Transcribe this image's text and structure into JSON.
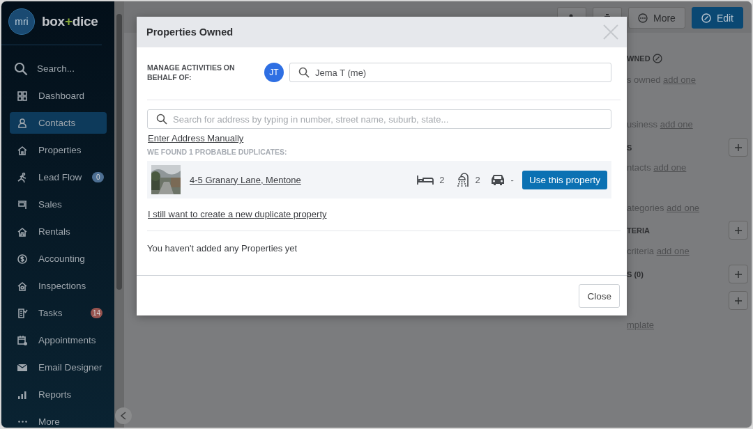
{
  "brand": {
    "mark": "mri",
    "word_1": "box",
    "joiner": "+",
    "word_2": "dice"
  },
  "sidebar": {
    "search": "Search...",
    "items": [
      {
        "label": "Dashboard",
        "selected": false
      },
      {
        "label": "Contacts",
        "selected": true
      },
      {
        "label": "Properties",
        "selected": false
      },
      {
        "label": "Lead Flow",
        "selected": false,
        "badge": {
          "text": "0",
          "color": "#4d6f93"
        }
      },
      {
        "label": "Sales",
        "selected": false
      },
      {
        "label": "Rentals",
        "selected": false
      },
      {
        "label": "Accounting",
        "selected": false
      },
      {
        "label": "Inspections",
        "selected": false
      },
      {
        "label": "Tasks",
        "selected": false,
        "badge": {
          "text": "14",
          "color": "#97544f"
        }
      },
      {
        "label": "Appointments",
        "selected": false
      },
      {
        "label": "Email Designer",
        "selected": false
      },
      {
        "label": "Reports",
        "selected": false
      },
      {
        "label": "More",
        "selected": false
      }
    ]
  },
  "page": {
    "actions": [
      {
        "kind": "secondary"
      },
      {
        "kind": "secondary"
      },
      {
        "label": "More",
        "kind": "secondary"
      },
      {
        "label": "Edit",
        "kind": "primary"
      }
    ]
  },
  "right_panel": [
    {
      "kind": "heading",
      "text": "WNED",
      "editable": true,
      "addable": false
    },
    {
      "kind": "hint",
      "text": "s owned",
      "link": "add one"
    },
    {
      "kind": "hint",
      "text": "usiness",
      "link": "add one"
    },
    {
      "kind": "heading",
      "text": "S",
      "editable": false,
      "addable": true
    },
    {
      "kind": "hint",
      "text": "ntacts",
      "link": "add one"
    },
    {
      "kind": "hint",
      "text": "ategories",
      "link": "add one"
    },
    {
      "kind": "heading",
      "text": "TERIA",
      "editable": false,
      "addable": true
    },
    {
      "kind": "hint",
      "text": "criteria",
      "link": "add one"
    },
    {
      "kind": "heading",
      "text": "S (0)",
      "editable": false,
      "addable": true
    },
    {
      "kind": "heading",
      "editable": false,
      "addable": true
    },
    {
      "kind": "hint",
      "link": "mplate"
    }
  ],
  "modal": {
    "title": "Properties Owned",
    "owner_label": "MANAGE ACTIVITIES ON BEHALF OF:",
    "owner_initials": "JT",
    "owner_value": "Jema T (me)",
    "address_search": {
      "placeholder": "Search for address by typing in number, street name, suburb, state..."
    },
    "manual_link": "Enter Address Manually",
    "duplicates_caption": "WE FOUND 1 PROBABLE DUPLICATES:",
    "duplicates": [
      {
        "address": "4-5 Granary Lane, Mentone",
        "beds": "2",
        "baths": "2",
        "cars": "-",
        "action": "Use this property"
      }
    ],
    "create_link": "I still want to create a new duplicate property",
    "empty_message": "You haven't added any Properties yet",
    "buttons": [
      "Close"
    ]
  }
}
